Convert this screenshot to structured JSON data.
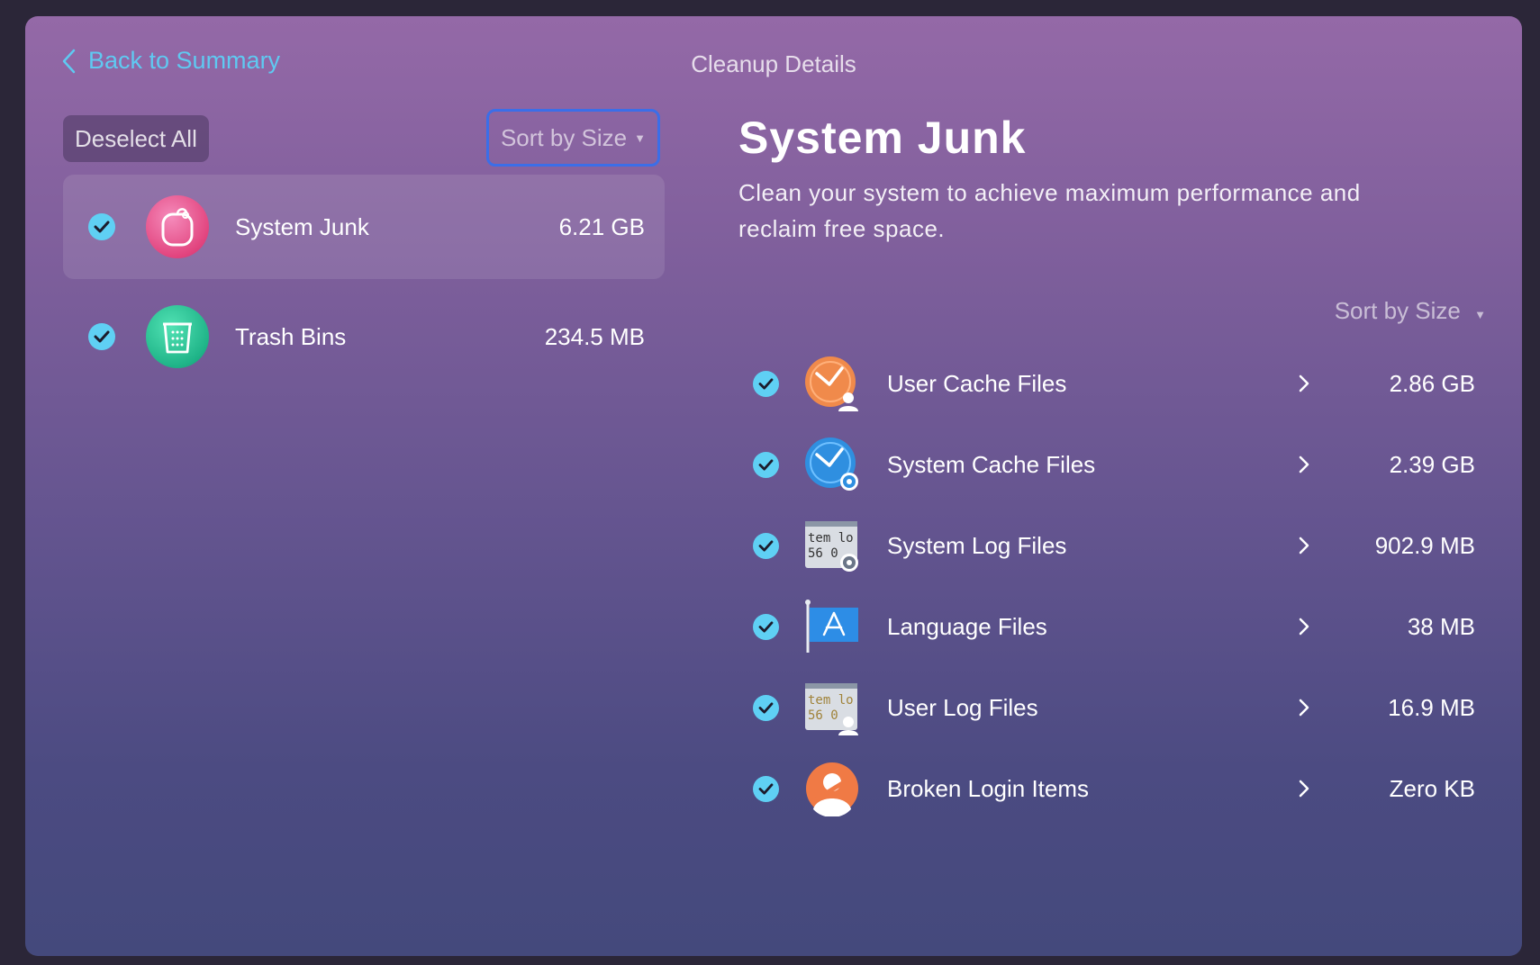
{
  "header": {
    "back_label": "Back to Summary",
    "title": "Cleanup Details"
  },
  "left_panel": {
    "deselect_label": "Deselect All",
    "sort_label": "Sort by Size",
    "categories": [
      {
        "label": "System Junk",
        "size": "6.21 GB",
        "checked": true,
        "selected": true,
        "icon": "system-junk-icon"
      },
      {
        "label": "Trash Bins",
        "size": "234.5 MB",
        "checked": true,
        "selected": false,
        "icon": "trash-bin-icon"
      }
    ]
  },
  "detail": {
    "title": "System Junk",
    "description": "Clean your system to achieve maximum performance and reclaim free space.",
    "sort_label": "Sort by Size",
    "items": [
      {
        "label": "User Cache Files",
        "size": "2.86 GB",
        "checked": true,
        "icon": "user-cache-icon"
      },
      {
        "label": "System Cache Files",
        "size": "2.39 GB",
        "checked": true,
        "icon": "system-cache-icon"
      },
      {
        "label": "System Log Files",
        "size": "902.9 MB",
        "checked": true,
        "icon": "system-log-icon"
      },
      {
        "label": "Language Files",
        "size": "38 MB",
        "checked": true,
        "icon": "language-files-icon"
      },
      {
        "label": "User Log Files",
        "size": "16.9 MB",
        "checked": true,
        "icon": "user-log-icon"
      },
      {
        "label": "Broken Login Items",
        "size": "Zero KB",
        "checked": true,
        "icon": "broken-login-icon"
      }
    ]
  },
  "colors": {
    "accent": "#5fc9f1",
    "check": "#5fd0f4",
    "focus_ring": "#3b6ee8"
  }
}
